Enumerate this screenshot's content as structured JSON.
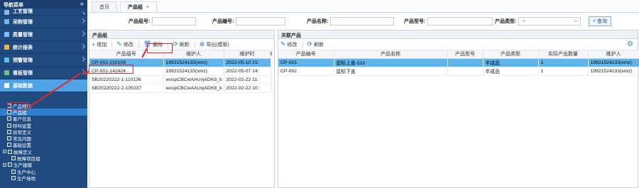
{
  "sidebar": {
    "title": "导航菜单",
    "collapse_glyph": "«",
    "menu": [
      {
        "label": "工艺管理",
        "icon_color": "#8bb6e8"
      },
      {
        "label": "采购管理",
        "icon_color": "#6fb7ef"
      },
      {
        "label": "质量管理",
        "icon_color": "#7fc0ff"
      },
      {
        "label": "统计报表",
        "icon_color": "#f0b04a"
      },
      {
        "label": "预警管理",
        "icon_color": "#58c1f0"
      },
      {
        "label": "看板管理",
        "icon_color": "#6ec07e"
      },
      {
        "label": "基础数据",
        "icon_color": "#ffffff"
      }
    ],
    "tree": [
      {
        "label": "产品物料",
        "indent": 1
      },
      {
        "label": "产品组",
        "indent": 1,
        "selected": true
      },
      {
        "label": "客户信息",
        "indent": 1
      },
      {
        "label": "呼叫设置",
        "indent": 1
      },
      {
        "label": "异常定义",
        "indent": 1
      },
      {
        "label": "常见问题",
        "indent": 1
      },
      {
        "label": "基础设置",
        "indent": 1
      },
      {
        "label": "故障定义",
        "indent": 0,
        "expander": true
      },
      {
        "label": "故障项目组",
        "indent": 2
      },
      {
        "label": "生产建模",
        "indent": 0,
        "expander": true
      },
      {
        "label": "生产中心",
        "indent": 2
      },
      {
        "label": "生产场地",
        "indent": 2
      }
    ]
  },
  "tabs": [
    {
      "label": "首页"
    },
    {
      "label": "产品组",
      "close": "×",
      "active": true
    }
  ],
  "search": {
    "group_no_label": "产品组号:",
    "product_no_label": "产品编号:",
    "product_name_label": "产品名称:",
    "product_model_label": "产品型号:",
    "product_type_label": "产品类型:",
    "product_type_value": "--",
    "query_label": "查询"
  },
  "left_panel": {
    "title": "产品组",
    "toolbar": {
      "add": "增加",
      "edit": "修改",
      "delete": "删除",
      "refresh": "刷新",
      "export": "导出(模板)"
    },
    "columns": [
      "产品组号",
      "维护人",
      "维护时"
    ],
    "rows": [
      [
        "CP-002-210109",
        "19921524133(xmz)",
        "2022-05-10 21:"
      ],
      [
        "CP-001-142424",
        "19921524133(xmz)",
        "2022-05-07 14:"
      ],
      [
        "SB20220222-1-110136",
        "wospCBCwAAUvjADK8_b",
        "2022-02-22 11:"
      ],
      [
        "SB20220222-2-105337",
        "wospCBCwAAUvjADK8_b",
        "2022-02-22 10:"
      ]
    ],
    "selected_index": 0
  },
  "right_panel": {
    "title": "关联产品",
    "toolbar": {
      "edit": "修改",
      "refresh": "刷新"
    },
    "columns": [
      "产品编号",
      "产品名称",
      "产品型号",
      "产品类型",
      "实际产出数量",
      "维护人"
    ],
    "rows": [
      [
        "CP-001",
        "鼠标上盖-510",
        "",
        "半成品",
        "1",
        "19921524133(xmz)"
      ],
      [
        "CP-002",
        "鼠标下盖",
        "",
        "半成品",
        "1",
        "19921524133(xmz)"
      ]
    ],
    "selected_index": 0
  },
  "colors": {
    "sidebar_bg": "#1f4b80",
    "active_menu": "#4fa2e6",
    "selected_row": "#5eb4ef",
    "annotation_red": "#e0292b"
  }
}
